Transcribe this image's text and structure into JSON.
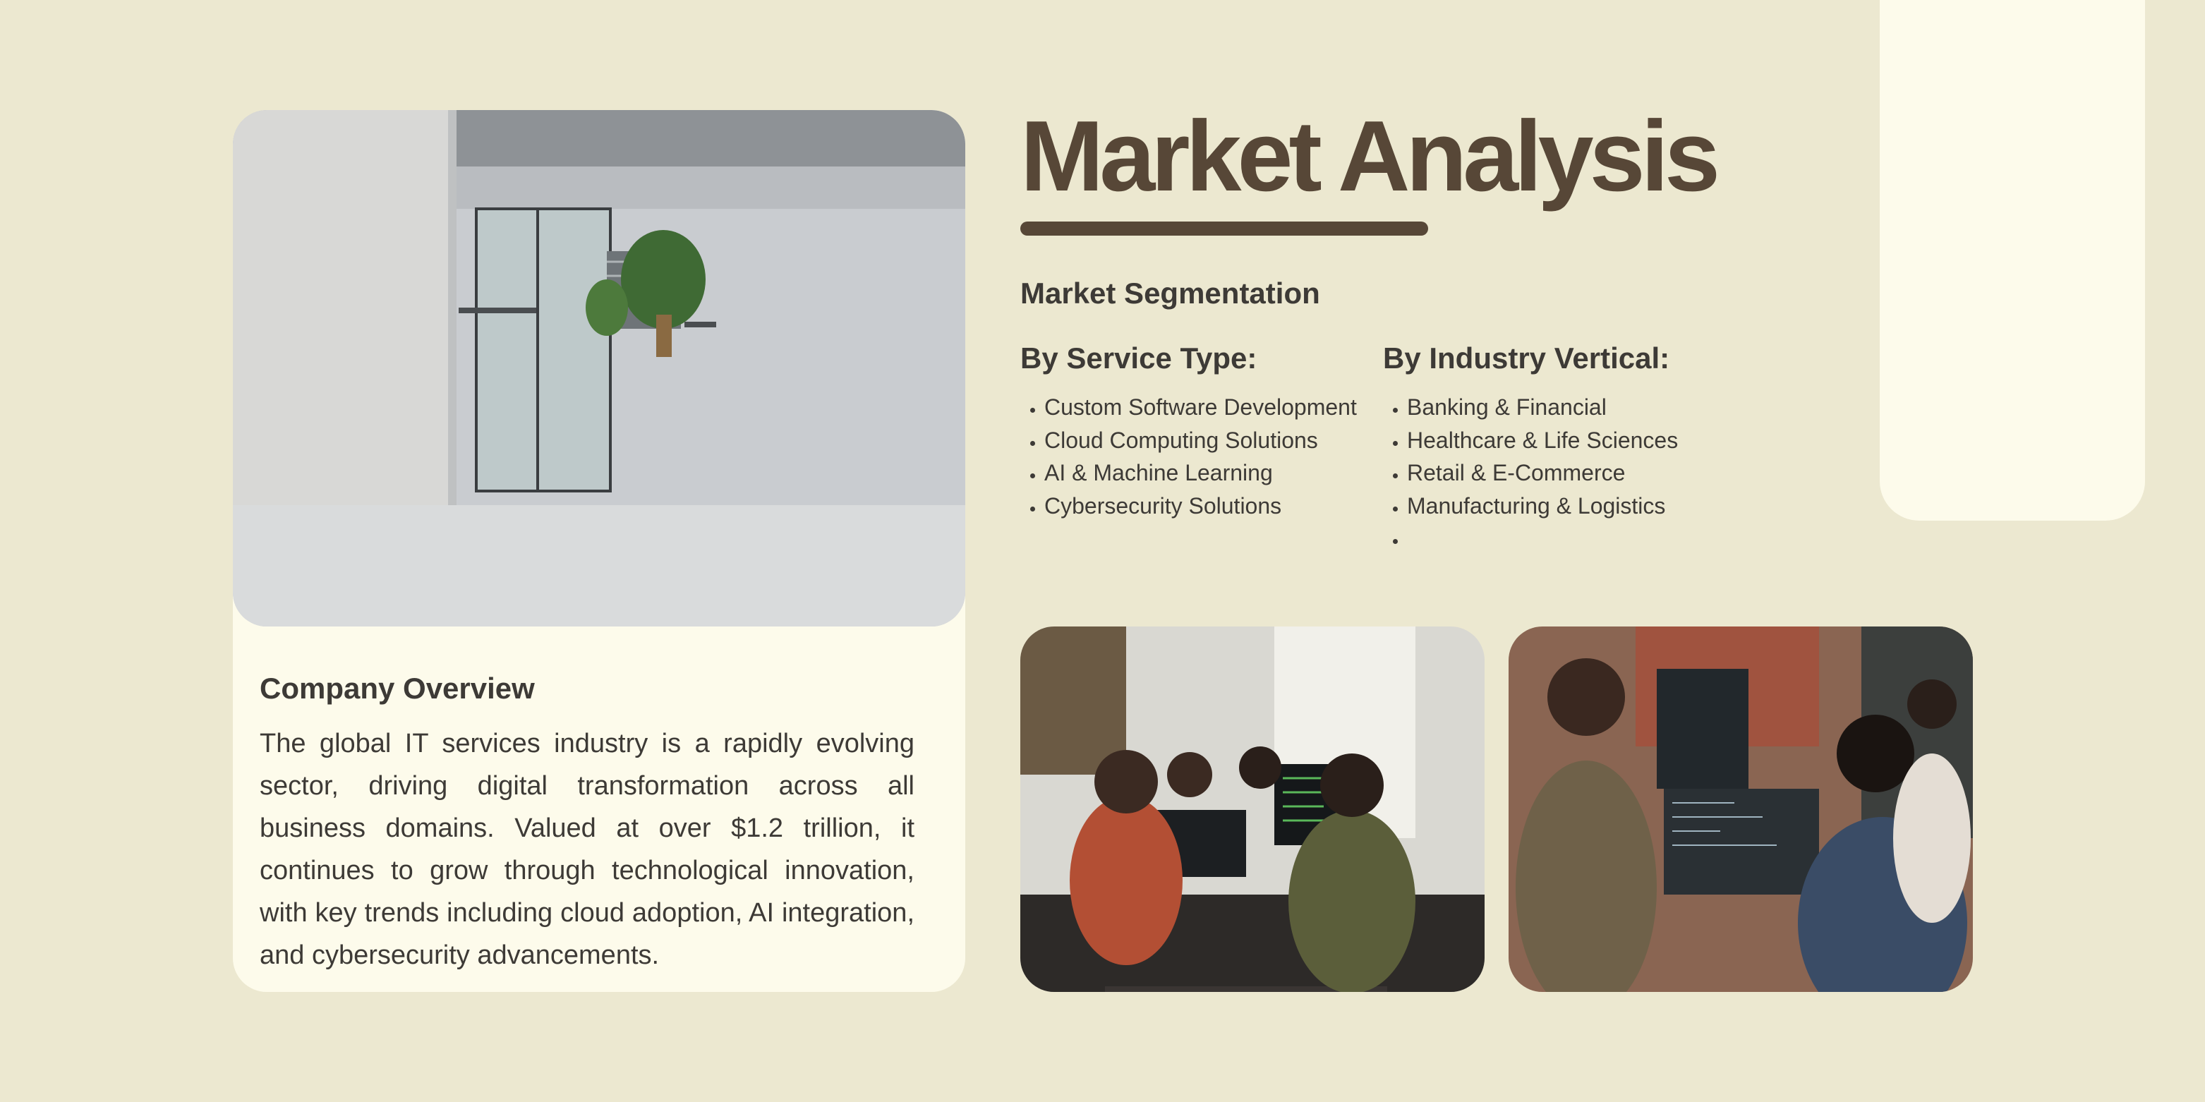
{
  "title": "Market Analysis",
  "segmentation_title": "Market Segmentation",
  "overview": {
    "title": "Company Overview",
    "text": "The global IT services industry is a rapidly evolving sector, driving digital transformation across all business domains. Valued at over $1.2 trillion, it continues to grow through technological innovation, with key trends including cloud adoption, AI integration, and cybersecurity advancements."
  },
  "service_type": {
    "heading": "By Service Type:",
    "items": [
      "Custom Software Development",
      "Cloud Computing Solutions",
      "AI & Machine Learning",
      "Cybersecurity Solutions"
    ]
  },
  "industry_vertical": {
    "heading": "By Industry Vertical:",
    "items": [
      "Banking & Financial",
      "Healthcare & Life Sciences",
      "Retail & E-Commerce",
      "Manufacturing & Logistics",
      ""
    ]
  },
  "colors": {
    "background": "#ece8d0",
    "card": "#fdfbeb",
    "title_brown": "#574737",
    "text_dark": "#3d3a36"
  }
}
